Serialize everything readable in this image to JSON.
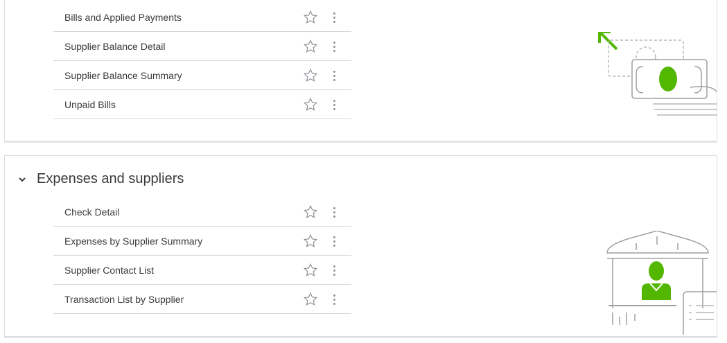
{
  "sections": [
    {
      "title": "",
      "reports": [
        "Bills and Applied Payments",
        "Supplier Balance Detail",
        "Supplier Balance Summary",
        "Unpaid Bills"
      ]
    },
    {
      "title": "Expenses and suppliers",
      "reports": [
        "Check Detail",
        "Expenses by Supplier Summary",
        "Supplier Contact List",
        "Transaction List by Supplier"
      ]
    }
  ],
  "colors": {
    "accent": "#53b700",
    "line": "#d4d7dc",
    "icon": "#8d9096"
  }
}
